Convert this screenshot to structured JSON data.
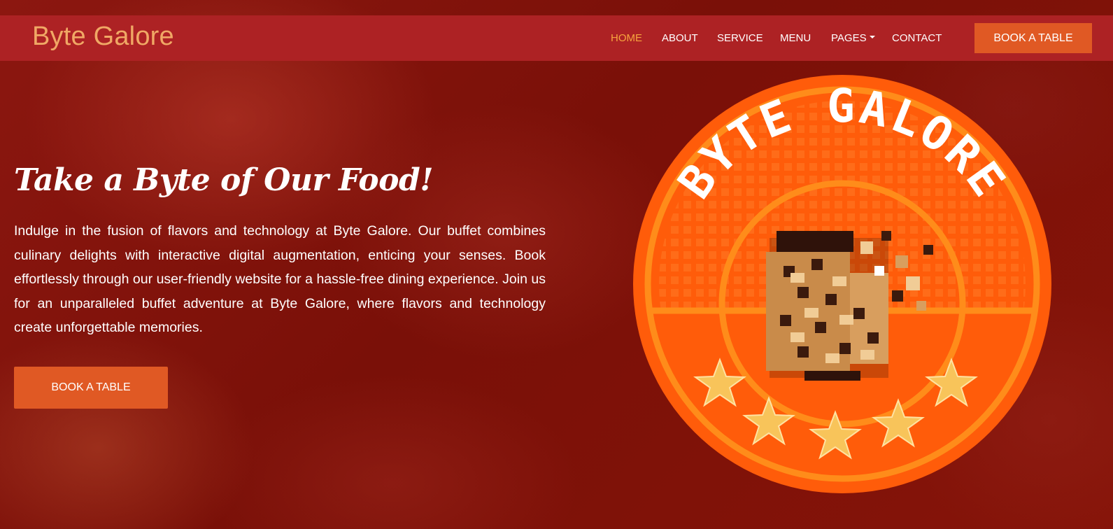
{
  "brand": {
    "name": "Byte Galore"
  },
  "nav": {
    "items": [
      {
        "label": "HOME",
        "active": true
      },
      {
        "label": "ABOUT",
        "active": false
      },
      {
        "label": "SERVICE",
        "active": false
      },
      {
        "label": "MENU",
        "active": false
      },
      {
        "label": "PAGES",
        "active": false,
        "has_dropdown": true
      },
      {
        "label": "CONTACT",
        "active": false
      }
    ],
    "cta_label": "BOOK A TABLE"
  },
  "hero": {
    "title": "Take a Byte of Our Food!",
    "description": "Indulge in the fusion of flavors and technology at Byte Galore. Our buffet combines culinary delights with interactive digital augmentation, enticing your senses. Book effortlessly through our user-friendly website for a hassle-free dining experience. Join us for an unparalleled buffet adventure at Byte Galore, where flavors and technology create unforgettable memories.",
    "cta_label": "BOOK A TABLE"
  },
  "logo": {
    "text": "BYTE GALORE",
    "icon": "pixel-cookie-icon",
    "stars": 5
  },
  "colors": {
    "navbar": "#ad2224",
    "brand": "#f0a865",
    "active_nav": "#f6a43e",
    "button": "#e05924",
    "logo_orange": "#ff5c0a",
    "logo_ring": "#ff8c1a"
  }
}
